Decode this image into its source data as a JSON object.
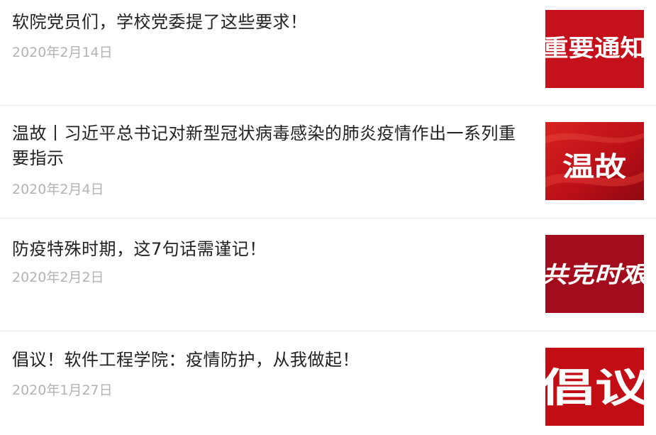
{
  "articles": [
    {
      "title": "软院党员们，学校党委提了这些要求！",
      "date": "2020年2月14日",
      "thumbnail_text": "重要通知",
      "thumbnail_color": "#c4111b"
    },
    {
      "title": "温故丨习近平总书记对新型冠状病毒感染的肺炎疫情作出一系列重要指示",
      "date": "2020年2月4日",
      "thumbnail_text": "温故",
      "thumbnail_color": "#c8121c"
    },
    {
      "title": "防疫特殊时期，这7句话需谨记！",
      "date": "2020年2月2日",
      "thumbnail_text": "共克时艰",
      "thumbnail_color": "#a30c1c"
    },
    {
      "title": "倡议！软件工程学院：疫情防护，从我做起！",
      "date": "2020年1月27日",
      "thumbnail_text": "倡议",
      "thumbnail_color": "#c30d14"
    }
  ]
}
